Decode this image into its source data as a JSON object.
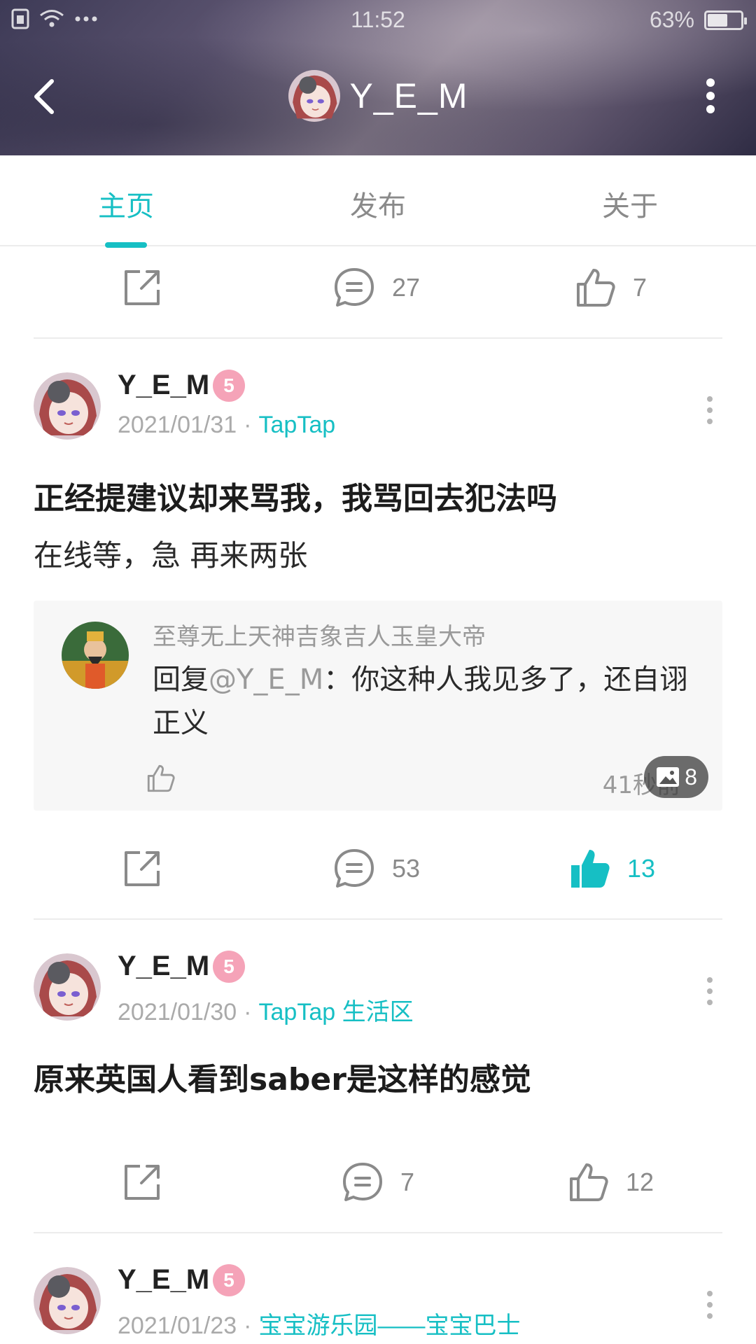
{
  "status_bar": {
    "time": "11:52",
    "battery": "63%",
    "battery_level": 0.63
  },
  "header": {
    "title": "Y_E_M"
  },
  "tabs": [
    {
      "label": "主页",
      "active": true
    },
    {
      "label": "发布",
      "active": false
    },
    {
      "label": "关于",
      "active": false
    }
  ],
  "top_actions": {
    "comments": "27",
    "likes": "7"
  },
  "posts": [
    {
      "author": "Y_E_M",
      "level": "5",
      "date": "2021/01/31",
      "separator": "·",
      "group": "TapTap",
      "title": "正经提建议却来骂我，我骂回去犯法吗",
      "body": "在线等，急 再来两张",
      "hot_reply": {
        "name": "至尊无上天神吉象吉人玉皇大帝",
        "prefix": "回复",
        "mention": "@Y_E_M",
        "text": "：你这种人我见多了，还自诩正义",
        "time": "41秒前",
        "image_count": "8"
      },
      "comments": "53",
      "likes": "13",
      "liked": true
    },
    {
      "author": "Y_E_M",
      "level": "5",
      "date": "2021/01/30",
      "separator": "·",
      "group": "TapTap 生活区",
      "title": "原来英国人看到saber是这样的感觉",
      "comments": "7",
      "likes": "12",
      "liked": false
    },
    {
      "author": "Y_E_M",
      "level": "5",
      "date": "2021/01/23",
      "separator": "·",
      "group": "宝宝游乐园——宝宝巴士"
    }
  ],
  "colors": {
    "accent": "#16bfc4",
    "muted": "#8a8a8a",
    "badge": "#f5a3b8"
  }
}
